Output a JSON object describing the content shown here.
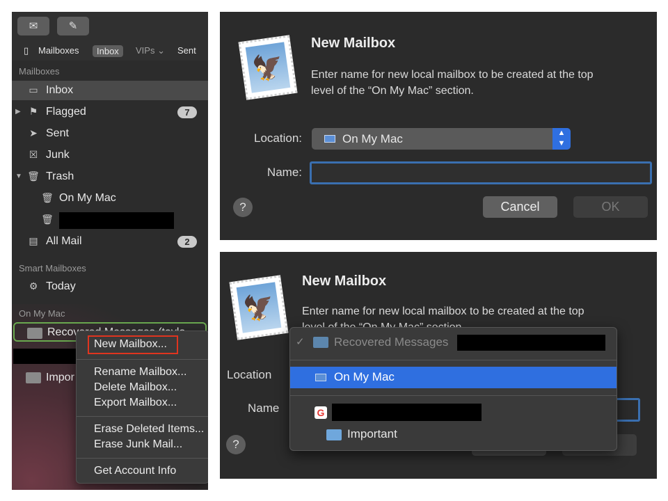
{
  "sidebar": {
    "toolbar": {
      "get_mail_icon": "envelope-icon",
      "compose_icon": "compose-icon"
    },
    "favorites": {
      "mailboxes": "Mailboxes",
      "inbox": "Inbox",
      "vips": "VIPs ⌄",
      "sent": "Sent"
    },
    "sections": {
      "mailboxes": "Mailboxes",
      "smart": "Smart Mailboxes",
      "on_my_mac": "On My Mac"
    },
    "items": {
      "inbox": "Inbox",
      "flagged": "Flagged",
      "flagged_count": "7",
      "sent": "Sent",
      "junk": "Junk",
      "trash": "Trash",
      "trash_on_my_mac": "On My Mac",
      "all_mail": "All Mail",
      "all_mail_count": "2",
      "today": "Today",
      "recovered": "Recovered Messages (taylo",
      "important": "Impor"
    }
  },
  "context_menu": {
    "new_mailbox": "New Mailbox...",
    "rename": "Rename Mailbox...",
    "delete": "Delete Mailbox...",
    "export": "Export Mailbox...",
    "erase_deleted": "Erase Deleted Items...",
    "erase_junk": "Erase Junk Mail...",
    "account_info": "Get Account Info"
  },
  "dialog_top": {
    "title": "New Mailbox",
    "description_line1": "Enter name for new local mailbox to be created at the top",
    "description_line2": "level of the “On My Mac” section.",
    "location_label": "Location:",
    "location_value": "On My Mac",
    "name_label": "Name:",
    "name_value": "",
    "help": "?",
    "cancel": "Cancel",
    "ok": "OK"
  },
  "dialog_bottom": {
    "title": "New Mailbox",
    "description_line1": "Enter name for new local mailbox to be created at the top",
    "description_line2_partial": "level of the “On My Mac” section.",
    "location_label": "Location",
    "name_label": "Name",
    "help": "?",
    "dropdown": {
      "checkmark": "✓",
      "recovered": "Recovered Messages",
      "on_my_mac": "On My Mac",
      "google_icon": "G",
      "important": "Important"
    }
  },
  "colors": {
    "accent": "#2f6fe0",
    "highlight_border": "#e0341f",
    "row_outline": "#6aa84f"
  }
}
